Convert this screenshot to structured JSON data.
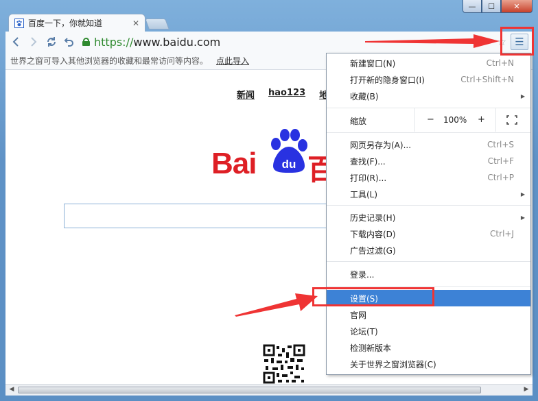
{
  "tab": {
    "favicon": "paw-favicon",
    "title": "百度一下，你就知道",
    "close": "✕"
  },
  "window": {
    "min": "—",
    "max": "☐",
    "close": "✕"
  },
  "toolbar": {
    "url_scheme": "https://",
    "url_host": "www.baidu.com",
    "menu_icon": "☰"
  },
  "hintbar": {
    "text": "世界之窗可导入其他浏览器的收藏和最常访问等内容。",
    "link": "点此导入"
  },
  "page": {
    "nav": [
      "新闻",
      "hao123",
      "地"
    ],
    "logo_text_left": "Bai",
    "logo_text_right": "百",
    "logo_du": "du"
  },
  "menu": {
    "items": [
      {
        "label": "新建窗口(N)",
        "shortcut": "Ctrl+N"
      },
      {
        "label": "打开新的隐身窗口(I)",
        "shortcut": "Ctrl+Shift+N"
      },
      {
        "label": "收藏(B)",
        "submenu": true
      },
      {
        "label": "网页另存为(A)...",
        "shortcut": "Ctrl+S"
      },
      {
        "label": "查找(F)...",
        "shortcut": "Ctrl+F"
      },
      {
        "label": "打印(R)...",
        "shortcut": "Ctrl+P"
      },
      {
        "label": "工具(L)",
        "submenu": true
      },
      {
        "label": "历史记录(H)",
        "submenu": true
      },
      {
        "label": "下载内容(D)",
        "shortcut": "Ctrl+J"
      },
      {
        "label": "广告过滤(G)"
      },
      {
        "label": "登录..."
      },
      {
        "label": "设置(S)",
        "active": true
      },
      {
        "label": "官网"
      },
      {
        "label": "论坛(T)"
      },
      {
        "label": "检测新版本"
      },
      {
        "label": "关于世界之窗浏览器(C)"
      }
    ],
    "zoom": {
      "label": "缩放",
      "minus": "−",
      "value": "100%",
      "plus": "+"
    }
  },
  "colors": {
    "accent": "#3d82d6",
    "annotation": "#ef3434",
    "logo_red": "#de1f25",
    "logo_blue": "#2932e1"
  }
}
